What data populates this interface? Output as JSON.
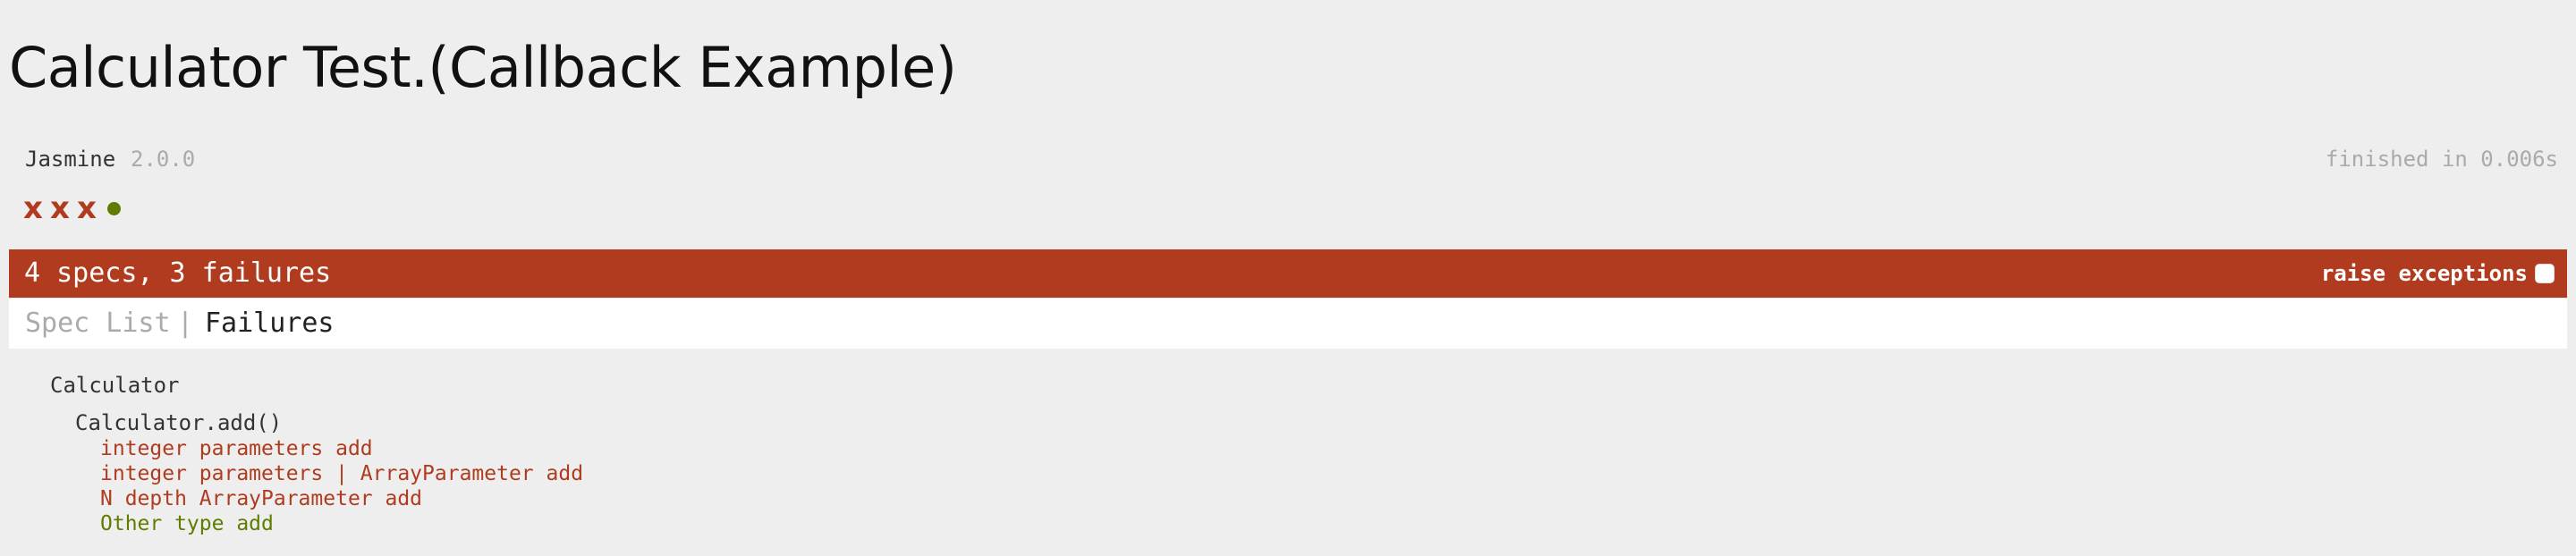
{
  "page": {
    "title": "Calculator Test.(Callback Example)"
  },
  "banner": {
    "name": "Jasmine",
    "version": "2.0.0",
    "duration": "finished in 0.006s"
  },
  "symbols": [
    {
      "status": "failed",
      "glyph": "x"
    },
    {
      "status": "failed",
      "glyph": "x"
    },
    {
      "status": "failed",
      "glyph": "x"
    },
    {
      "status": "passed",
      "glyph": "●"
    }
  ],
  "alert": {
    "summary": "4 specs, 3 failures",
    "raise_exceptions_label": "raise exceptions",
    "raise_exceptions_checked": false
  },
  "menu": {
    "spec_list": "Spec List",
    "separator": "|",
    "failures": "Failures"
  },
  "results": {
    "suite": "Calculator",
    "inner_suite": "Calculator.add()",
    "specs": [
      {
        "label": "integer parameters add",
        "status": "failed"
      },
      {
        "label": "integer parameters | ArrayParameter add",
        "status": "failed"
      },
      {
        "label": "N depth ArrayParameter add",
        "status": "failed"
      },
      {
        "label": "Other type add",
        "status": "passed"
      }
    ]
  },
  "colors": {
    "failed": "#b03b1e",
    "passed": "#5e7d00",
    "background": "#eeeeee",
    "muted": "#aaaaaa"
  }
}
